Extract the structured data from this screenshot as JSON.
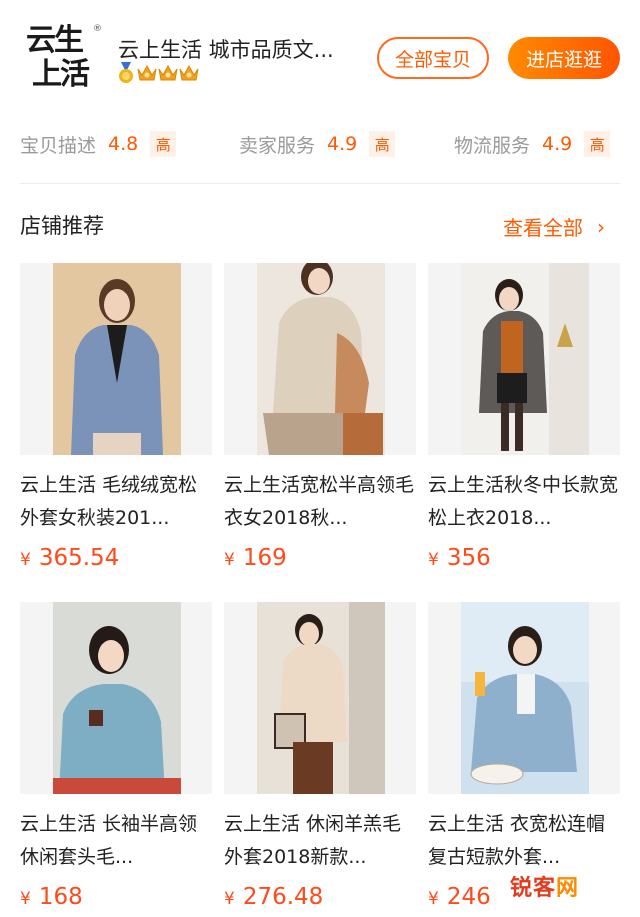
{
  "shop": {
    "logo_line1": "云生",
    "logo_line2": "上活",
    "logo_reg": "®",
    "name": "云上生活 城市品质文...",
    "btn_all": "全部宝贝",
    "btn_enter": "进店逛逛"
  },
  "ratings": [
    {
      "label": "宝贝描述",
      "value": "4.8",
      "level": "高"
    },
    {
      "label": "卖家服务",
      "value": "4.9",
      "level": "高"
    },
    {
      "label": "物流服务",
      "value": "4.9",
      "level": "高"
    }
  ],
  "section": {
    "title": "店铺推荐",
    "view_all": "查看全部",
    "chevron": "›"
  },
  "products": [
    {
      "title": "云上生活 毛绒绒宽松外套女秋装201...",
      "yen": "¥",
      "price": "365.54"
    },
    {
      "title": "云上生活宽松半高领毛衣女2018秋...",
      "yen": "¥",
      "price": "169"
    },
    {
      "title": "云上生活秋冬中长款宽松上衣2018...",
      "yen": "¥",
      "price": "356"
    },
    {
      "title": "云上生活 长袖半高领休闲套头毛...",
      "yen": "¥",
      "price": "168"
    },
    {
      "title": "云上生活 休闲羊羔毛外套2018新款...",
      "yen": "¥",
      "price": "276.48"
    },
    {
      "title": "云上生活 衣宽松连帽复古短款外套...",
      "yen": "¥",
      "price": "246"
    }
  ],
  "watermark": {
    "part1": "锐客",
    "part2": "网"
  },
  "colors": {
    "accent": "#ff5a00",
    "price": "#ff4a1a"
  },
  "icons": [
    "medal-icon",
    "crown-icon",
    "chevron-right-icon"
  ]
}
